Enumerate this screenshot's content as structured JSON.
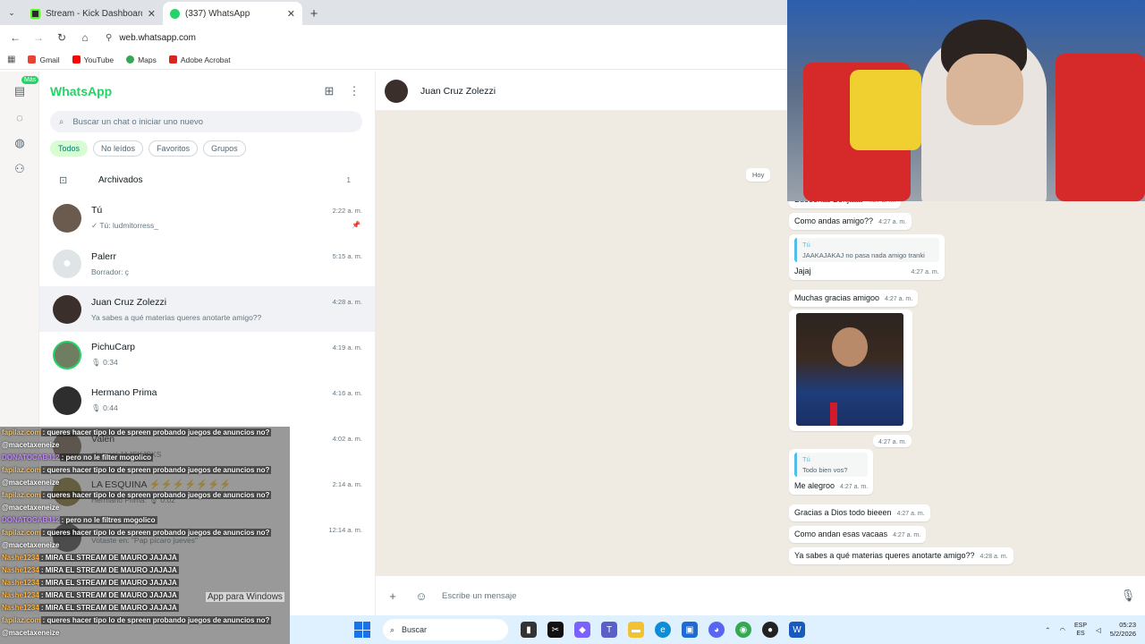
{
  "browser": {
    "tabs": [
      {
        "title": "Stream - Kick Dashboard",
        "favicon_color": "#53fc18",
        "active": false
      },
      {
        "title": "(337) WhatsApp",
        "favicon_color": "#25d366",
        "active": true
      }
    ],
    "url": "web.whatsapp.com",
    "bookmarks": [
      {
        "label": "Gmail",
        "color": "#ea4335"
      },
      {
        "label": "YouTube",
        "color": "#ff0000"
      },
      {
        "label": "Maps",
        "color": "#34a853"
      },
      {
        "label": "Adobe Acrobat",
        "color": "#d7261e"
      }
    ]
  },
  "rail": {
    "badge": "Más"
  },
  "sidebar": {
    "title": "WhatsApp",
    "search_placeholder": "Buscar un chat o iniciar uno nuevo",
    "filters": [
      "Todos",
      "No leídos",
      "Favoritos",
      "Grupos"
    ],
    "archived": {
      "label": "Archivados",
      "count": "1"
    },
    "chats": [
      {
        "name": "Tú",
        "preview": "✓ Tú: ludmitorress_",
        "time": "2:22 a. m.",
        "pinned": true,
        "avatar_color": "#6b5a4e"
      },
      {
        "name": "Palerr",
        "preview": "Borrador: ç",
        "draft": true,
        "time": "5:15 a. m.",
        "avatar_color": "#dfe5e7"
      },
      {
        "name": "Juan Cruz Zolezzi",
        "preview": "Ya sabes a qué materias queres anotarte amigo??",
        "time": "4:28 a. m.",
        "active": true,
        "avatar_color": "#3a2f2a"
      },
      {
        "name": "PichuCarp",
        "preview": "🎙 0:34",
        "time": "4:19 a. m.",
        "avatar_color": "#6f7d60"
      },
      {
        "name": "Hermano Prima",
        "preview": "🎙 0:44",
        "time": "4:16 a. m.",
        "avatar_color": "#2e2e2e"
      },
      {
        "name": "Valen",
        "preview": "algo asi JAJSKJSKS",
        "time": "4:02 a. m.",
        "avatar_color": "#7a6a5a"
      },
      {
        "name": "LA ESQUINA ⚡⚡⚡⚡⚡⚡⚡",
        "preview": "Hermano Prima: 🎙 0:02",
        "time": "2:14 a. m.",
        "avatar_color": "#8a7a3a"
      },
      {
        "name": "",
        "preview": "Votaste en: \"Pap pícaro jueves\"",
        "time": "12:14 a. m.",
        "avatar_color": "#555"
      }
    ]
  },
  "conversation": {
    "contact": "Juan Cruz Zolezzi",
    "day": "Hoy",
    "messages": [
      {
        "text": "Bueeenas Benjaaa",
        "time": "4:27 a. m."
      },
      {
        "text": "Como andas amigo??",
        "time": "4:27 a. m."
      },
      {
        "quote_author": "Tú",
        "quote_text": "JAAKAJAKAJ no pasa nada amigo tranki",
        "text": "Jajaj",
        "time": "4:27 a. m."
      },
      {
        "text": "Muchas gracias amigoo",
        "time": "4:27 a. m."
      },
      {
        "image": true,
        "time": "4:27 a. m."
      },
      {
        "quote_author": "Tú",
        "quote_text": "Todo bien vos?",
        "text": "Me alegroo",
        "time": "4:27 a. m."
      },
      {
        "text": "Gracias a Dios todo bieeen",
        "time": "4:27 a. m."
      },
      {
        "text": "Como andan esas vacaas",
        "time": "4:27 a. m."
      },
      {
        "text": "Ya sabes a qué materias queres anotarte amigo??",
        "time": "4:28 a. m."
      }
    ],
    "composer_placeholder": "Escribe un mensaje"
  },
  "stream_chat": [
    {
      "user": "fapilaz.com",
      "msg": ": queres hacer tipo lo de spreen probando juegos de anuncios no?"
    },
    {
      "user": "@macetaxeneize",
      "msg": ""
    },
    {
      "user": "DONATOCABJ12",
      "msg": ": pero no le filter mogolico"
    },
    {
      "user": "fapilaz.com",
      "msg": ": queres hacer tipo lo de spreen probando juegos de anuncios no?"
    },
    {
      "user": "@macetaxeneize",
      "msg": ""
    },
    {
      "user": "fapilaz.com",
      "msg": ": queres hacer tipo lo de spreen probando juegos de anuncios no?"
    },
    {
      "user": "@macetaxeneize",
      "msg": ""
    },
    {
      "user": "DONATOCABJ12",
      "msg": ": pero no le filtres mogolico"
    },
    {
      "user": "fapilaz.com",
      "msg": ": queres hacer tipo lo de spreen probando juegos de anuncios no?"
    },
    {
      "user": "@macetaxeneize",
      "msg": ""
    },
    {
      "user": "Nashe1234",
      "msg": ": MIRA EL STREAM DE MAURO JAJAJA"
    },
    {
      "user": "Nashe1234",
      "msg": ": MIRA EL STREAM DE MAURO JAJAJA"
    },
    {
      "user": "Nashe1234",
      "msg": ": MIRA EL STREAM DE MAURO JAJAJA"
    },
    {
      "user": "Nashe1234",
      "msg": ": MIRA EL STREAM DE MAURO JAJAJA"
    },
    {
      "user": "Nashe1234",
      "msg": ": MIRA EL STREAM DE MAURO JAJAJA"
    },
    {
      "user": "fapilaz.com",
      "msg": ": queres hacer tipo lo de spreen probando juegos de anuncios no?"
    },
    {
      "user": "@macetaxeneize",
      "msg": ""
    }
  ],
  "stream_chat_overflow": "App para Windows",
  "taskbar": {
    "search": "Buscar",
    "lang": "ESP",
    "lang2": "ES",
    "time": "05:23",
    "date": "5/2/2026"
  }
}
